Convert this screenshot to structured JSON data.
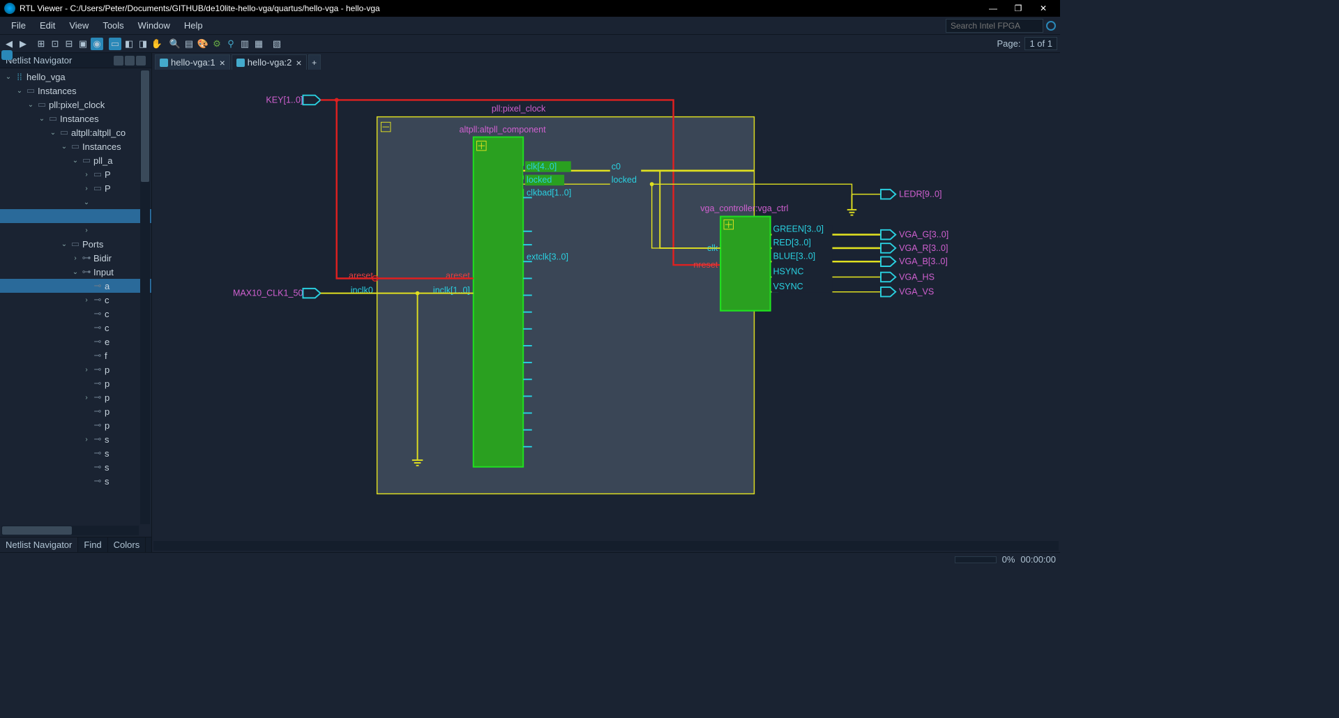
{
  "window": {
    "title": "RTL Viewer - C:/Users/Peter/Documents/GITHUB/de10lite-hello-vga/quartus/hello-vga - hello-vga"
  },
  "menu": [
    "File",
    "Edit",
    "View",
    "Tools",
    "Window",
    "Help"
  ],
  "search_placeholder": "Search Intel FPGA",
  "pager": {
    "label": "Page:",
    "value": "1 of 1"
  },
  "sidebar": {
    "title": "Netlist Navigator",
    "tabs": [
      "Netlist Navigator",
      "Find",
      "Colors"
    ],
    "tree": {
      "root": "hello_vga",
      "instances": "Instances",
      "pll": "pll:pixel_clock",
      "instances2": "Instances",
      "altpll": "altpll:altpll_co",
      "instances3": "Instances",
      "pll_a": "pll_a",
      "p1": "P",
      "p2": "P",
      "ports": "Ports",
      "bidir": "Bidir",
      "input": "Input",
      "i": {
        "a": "a",
        "c": "c",
        "c2": "c",
        "c3": "c",
        "e": "e",
        "f": "f",
        "p": "p",
        "p2": "p",
        "p3": "p",
        "p4": "p",
        "p5": "p",
        "s": "s",
        "s2": "s",
        "s3": "s",
        "s4": "s"
      }
    }
  },
  "doc_tabs": [
    "hello-vga:1",
    "hello-vga:2"
  ],
  "schematic": {
    "key": "KEY[1..0]",
    "max10": "MAX10_CLK1_50",
    "pll_title": "pll:pixel_clock",
    "altpll_title": "altpll:altpll_component",
    "ports_altpll": {
      "clk": "clk[4..0]",
      "locked": "locked",
      "clkbad": "clkbad[1..0]",
      "extclk": "extclk[3..0]",
      "areset_in": "areset",
      "areset_out": "areset",
      "inclk_in": "inclk0",
      "inclk_bus": "inclk[1..0]"
    },
    "pll_out": {
      "c0": "c0",
      "locked": "locked"
    },
    "vga_title": "vga_controller:vga_ctrl",
    "vga_ports": {
      "clk": "clk",
      "nreset": "nreset",
      "green": "GREEN[3..0]",
      "red": "RED[3..0]",
      "blue": "BLUE[3..0]",
      "hsync": "HSYNC",
      "vsync": "VSYNC"
    },
    "outputs": {
      "ledr": "LEDR[9..0]",
      "vga_g": "VGA_G[3..0]",
      "vga_r": "VGA_R[3..0]",
      "vga_b": "VGA_B[3..0]",
      "vga_hs": "VGA_HS",
      "vga_vs": "VGA_VS"
    }
  },
  "status": {
    "pct": "0%",
    "time": "00:00:00"
  }
}
